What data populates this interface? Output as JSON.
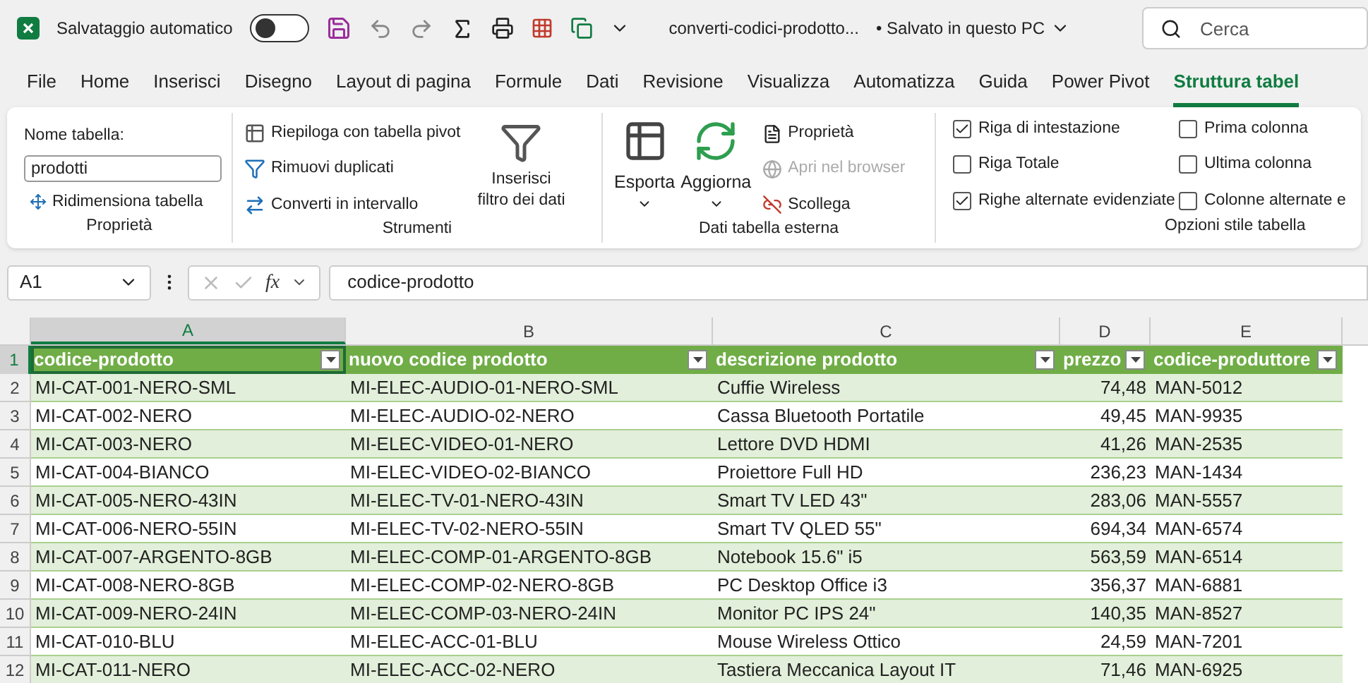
{
  "title_bar": {
    "autosave_label": "Salvataggio automatico",
    "autosave_on": false,
    "filename": "converti-codici-prodotto...",
    "save_status": "• Salvato in questo PC",
    "search_placeholder": "Cerca"
  },
  "menu_tabs": [
    {
      "label": "File",
      "selected": false
    },
    {
      "label": "Home",
      "selected": false
    },
    {
      "label": "Inserisci",
      "selected": false
    },
    {
      "label": "Disegno",
      "selected": false
    },
    {
      "label": "Layout di pagina",
      "selected": false
    },
    {
      "label": "Formule",
      "selected": false
    },
    {
      "label": "Dati",
      "selected": false
    },
    {
      "label": "Revisione",
      "selected": false
    },
    {
      "label": "Visualizza",
      "selected": false
    },
    {
      "label": "Automatizza",
      "selected": false
    },
    {
      "label": "Guida",
      "selected": false
    },
    {
      "label": "Power Pivot",
      "selected": false
    },
    {
      "label": "Struttura tabel",
      "selected": true
    }
  ],
  "ribbon": {
    "properties": {
      "name_label": "Nome tabella:",
      "table_name": "prodotti",
      "resize": "Ridimensiona tabella",
      "title": "Proprietà"
    },
    "tools": {
      "items": [
        "Riepiloga con tabella pivot",
        "Rimuovi duplicati",
        "Converti in intervallo"
      ],
      "slicer": [
        "Inserisci",
        "filtro dei dati"
      ],
      "title": "Strumenti"
    },
    "external": {
      "export": "Esporta",
      "refresh": "Aggiorna",
      "items": [
        {
          "label": "Proprietà",
          "disabled": false
        },
        {
          "label": "Apri nel browser",
          "disabled": true
        },
        {
          "label": "Scollega",
          "disabled": false
        }
      ],
      "title": "Dati tabella esterna"
    },
    "style_options": {
      "options": [
        {
          "label": "Riga di intestazione",
          "checked": true
        },
        {
          "label": "Riga Totale",
          "checked": false
        },
        {
          "label": "Righe alternate evidenziate",
          "checked": true
        },
        {
          "label": "Prima colonna",
          "checked": false
        },
        {
          "label": "Ultima colonna",
          "checked": false
        },
        {
          "label": "Colonne alternate e",
          "checked": false
        }
      ],
      "title": "Opzioni stile tabella"
    }
  },
  "formula_bar": {
    "name_box": "A1",
    "fx_label": "fx",
    "formula": "codice-prodotto"
  },
  "sheet": {
    "columns": [
      {
        "letter": "A",
        "selected": true
      },
      {
        "letter": "B",
        "selected": false
      },
      {
        "letter": "C",
        "selected": false
      },
      {
        "letter": "D",
        "selected": false
      },
      {
        "letter": "E",
        "selected": false
      }
    ],
    "header_row": {
      "number": "1",
      "cells": [
        "codice-prodotto",
        "nuovo codice prodotto",
        "descrizione prodotto",
        "prezzo",
        "codice-produttore"
      ]
    },
    "rows": [
      {
        "number": "2",
        "cells": [
          "MI-CAT-001-NERO-SML",
          "MI-ELEC-AUDIO-01-NERO-SML",
          "Cuffie Wireless",
          "74,48",
          "MAN-5012"
        ]
      },
      {
        "number": "3",
        "cells": [
          "MI-CAT-002-NERO",
          "MI-ELEC-AUDIO-02-NERO",
          "Cassa Bluetooth Portatile",
          "49,45",
          "MAN-9935"
        ]
      },
      {
        "number": "4",
        "cells": [
          "MI-CAT-003-NERO",
          "MI-ELEC-VIDEO-01-NERO",
          "Lettore DVD HDMI",
          "41,26",
          "MAN-2535"
        ]
      },
      {
        "number": "5",
        "cells": [
          "MI-CAT-004-BIANCO",
          "MI-ELEC-VIDEO-02-BIANCO",
          "Proiettore Full HD",
          "236,23",
          "MAN-1434"
        ]
      },
      {
        "number": "6",
        "cells": [
          "MI-CAT-005-NERO-43IN",
          "MI-ELEC-TV-01-NERO-43IN",
          "Smart TV LED 43\"",
          "283,06",
          "MAN-5557"
        ]
      },
      {
        "number": "7",
        "cells": [
          "MI-CAT-006-NERO-55IN",
          "MI-ELEC-TV-02-NERO-55IN",
          "Smart TV QLED 55\"",
          "694,34",
          "MAN-6574"
        ]
      },
      {
        "number": "8",
        "cells": [
          "MI-CAT-007-ARGENTO-8GB",
          "MI-ELEC-COMP-01-ARGENTO-8GB",
          "Notebook 15.6\" i5",
          "563,59",
          "MAN-6514"
        ]
      },
      {
        "number": "9",
        "cells": [
          "MI-CAT-008-NERO-8GB",
          "MI-ELEC-COMP-02-NERO-8GB",
          "PC Desktop Office i3",
          "356,37",
          "MAN-6881"
        ]
      },
      {
        "number": "10",
        "cells": [
          "MI-CAT-009-NERO-24IN",
          "MI-ELEC-COMP-03-NERO-24IN",
          "Monitor PC IPS 24\"",
          "140,35",
          "MAN-8527"
        ]
      },
      {
        "number": "11",
        "cells": [
          "MI-CAT-010-BLU",
          "MI-ELEC-ACC-01-BLU",
          "Mouse Wireless Ottico",
          "24,59",
          "MAN-7201"
        ]
      },
      {
        "number": "12",
        "cells": [
          "MI-CAT-011-NERO",
          "MI-ELEC-ACC-02-NERO",
          "Tastiera Meccanica Layout IT",
          "71,46",
          "MAN-6925"
        ]
      }
    ]
  }
}
